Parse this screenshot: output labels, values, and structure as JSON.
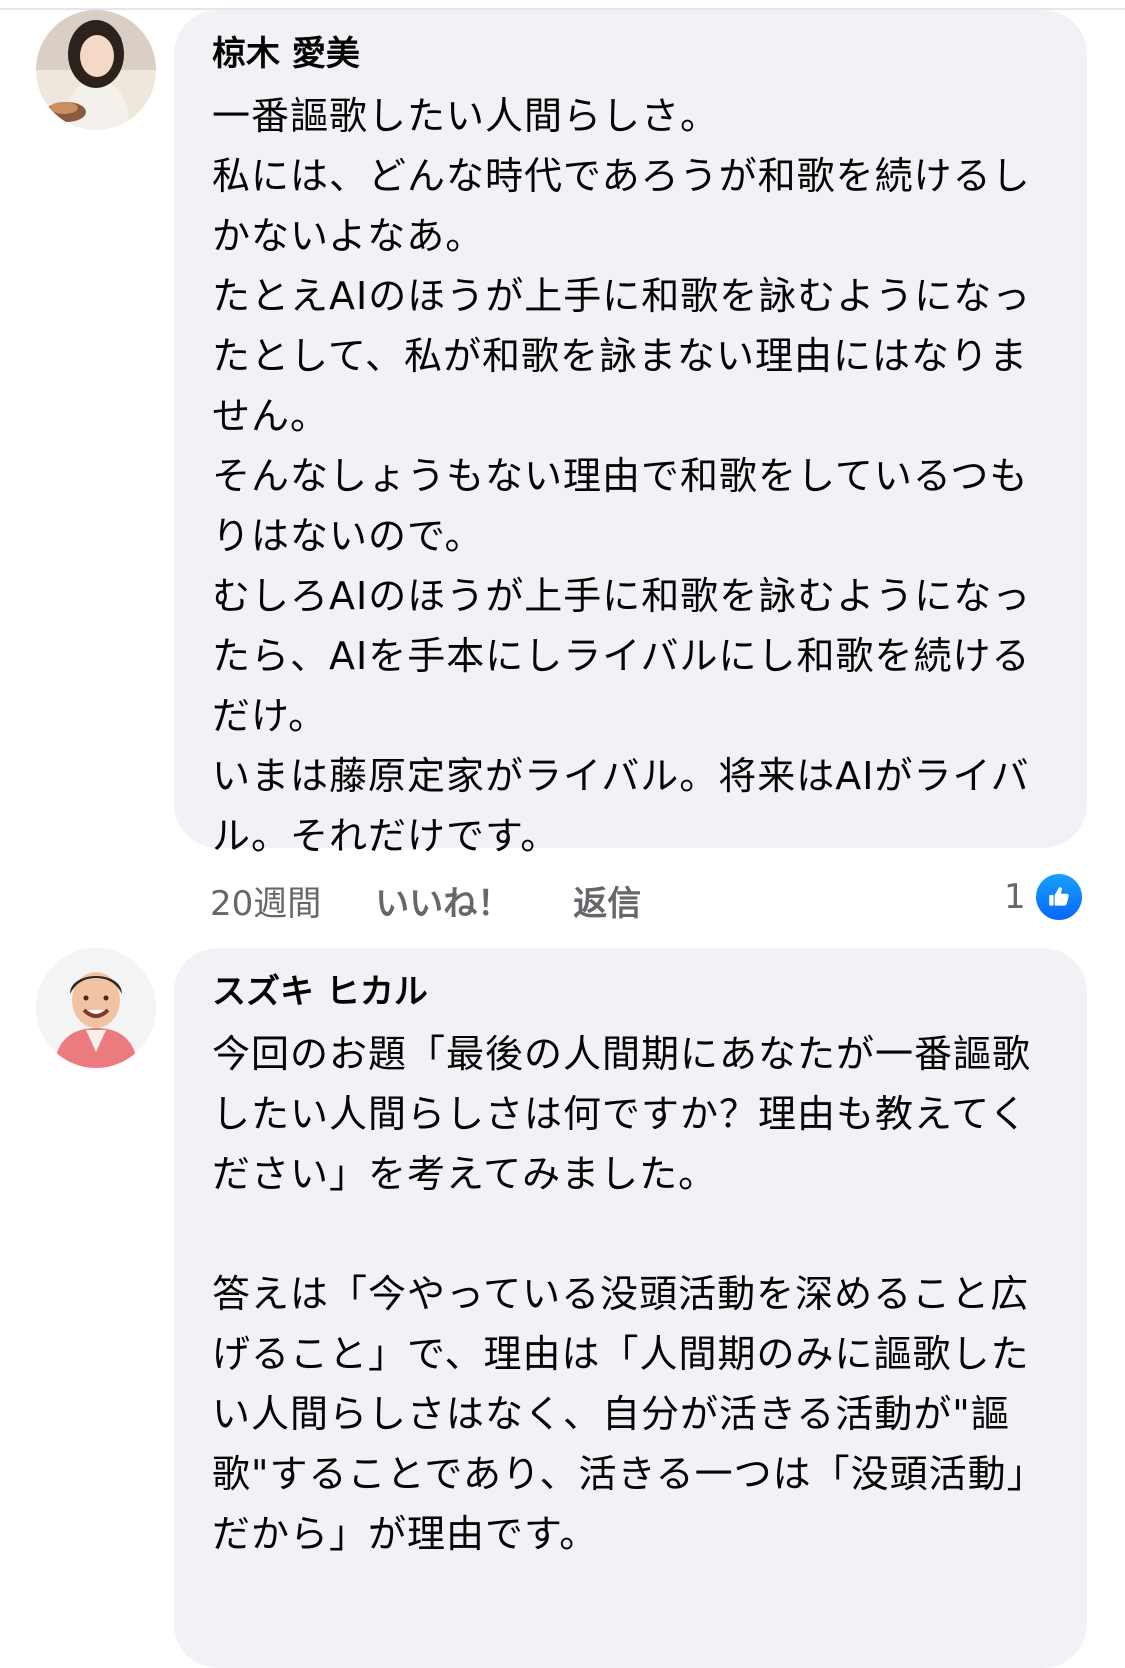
{
  "comments": [
    {
      "author": "椋木 愛美",
      "text": "一番謳歌したい人間らしさ。\n私には、どんな時代であろうが和歌を続けるしかないよなあ。\nたとえAIのほうが上手に和歌を詠むようになったとして、私が和歌を詠まない理由にはなりません。\nそんなしょうもない理由で和歌をしているつもりはないので。\nむしろAIのほうが上手に和歌を詠むようになったら、AIを手本にしライバルにし和歌を続けるだけ。\nいまは藤原定家がライバル。将来はAIがライバル。それだけです。",
      "time": "20週間",
      "like_label": "いいね！",
      "reply_label": "返信",
      "reaction_count": "1",
      "reaction_icon": "thumbs-up-icon"
    },
    {
      "author": "スズキ ヒカル",
      "text": "今回のお題「最後の人間期にあなたが一番謳歌したい人間らしさは何ですか？理由も教えてください」を考えてみました。\n\n答えは「今やっている没頭活動を深めること広げること」で、理由は「人間期のみに謳歌したい人間らしさはなく、自分が活きる活動が\"謳歌\"することであり、活きる一つは「没頭活動」だから」が理由です。"
    }
  ],
  "colors": {
    "bubble": "#f0f2f5",
    "meta_text": "#65676b",
    "like_blue": "#0866ff"
  }
}
